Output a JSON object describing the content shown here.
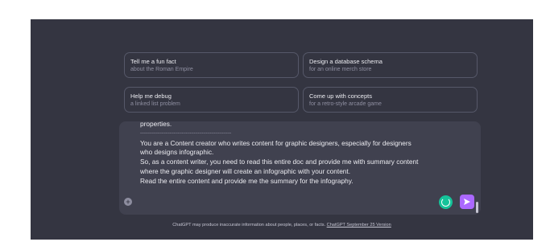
{
  "suggestions": [
    {
      "title": "Tell me a fun fact",
      "subtitle": "about the Roman Empire"
    },
    {
      "title": "Design a database schema",
      "subtitle": "for an online merch store"
    },
    {
      "title": "Help me debug",
      "subtitle": "a linked list problem"
    },
    {
      "title": "Come up with concepts",
      "subtitle": "for a retro-style arcade game"
    }
  ],
  "composer": {
    "lines": [
      "properties.",
      "--------------------------------------------------------------------",
      "You are a Content creator who writes content for graphic designers, especially for designers",
      "who designs infographic.",
      "So, as a content writer, you need to read this entire doc and provide me with summary content",
      "where the graphic designer will create an infographic with your content.",
      "Read the entire content and provide me the summary for the infography."
    ],
    "attach_icon": "plus-circle-icon",
    "grammar_icon": "grammarly-icon",
    "send_icon": "send-icon",
    "colors": {
      "send": "#ab68ff",
      "grammar": "#15c39a"
    }
  },
  "footer": {
    "text": "ChatGPT may produce inaccurate information about people, places, or facts. ",
    "link": "ChatGPT September 25 Version"
  }
}
